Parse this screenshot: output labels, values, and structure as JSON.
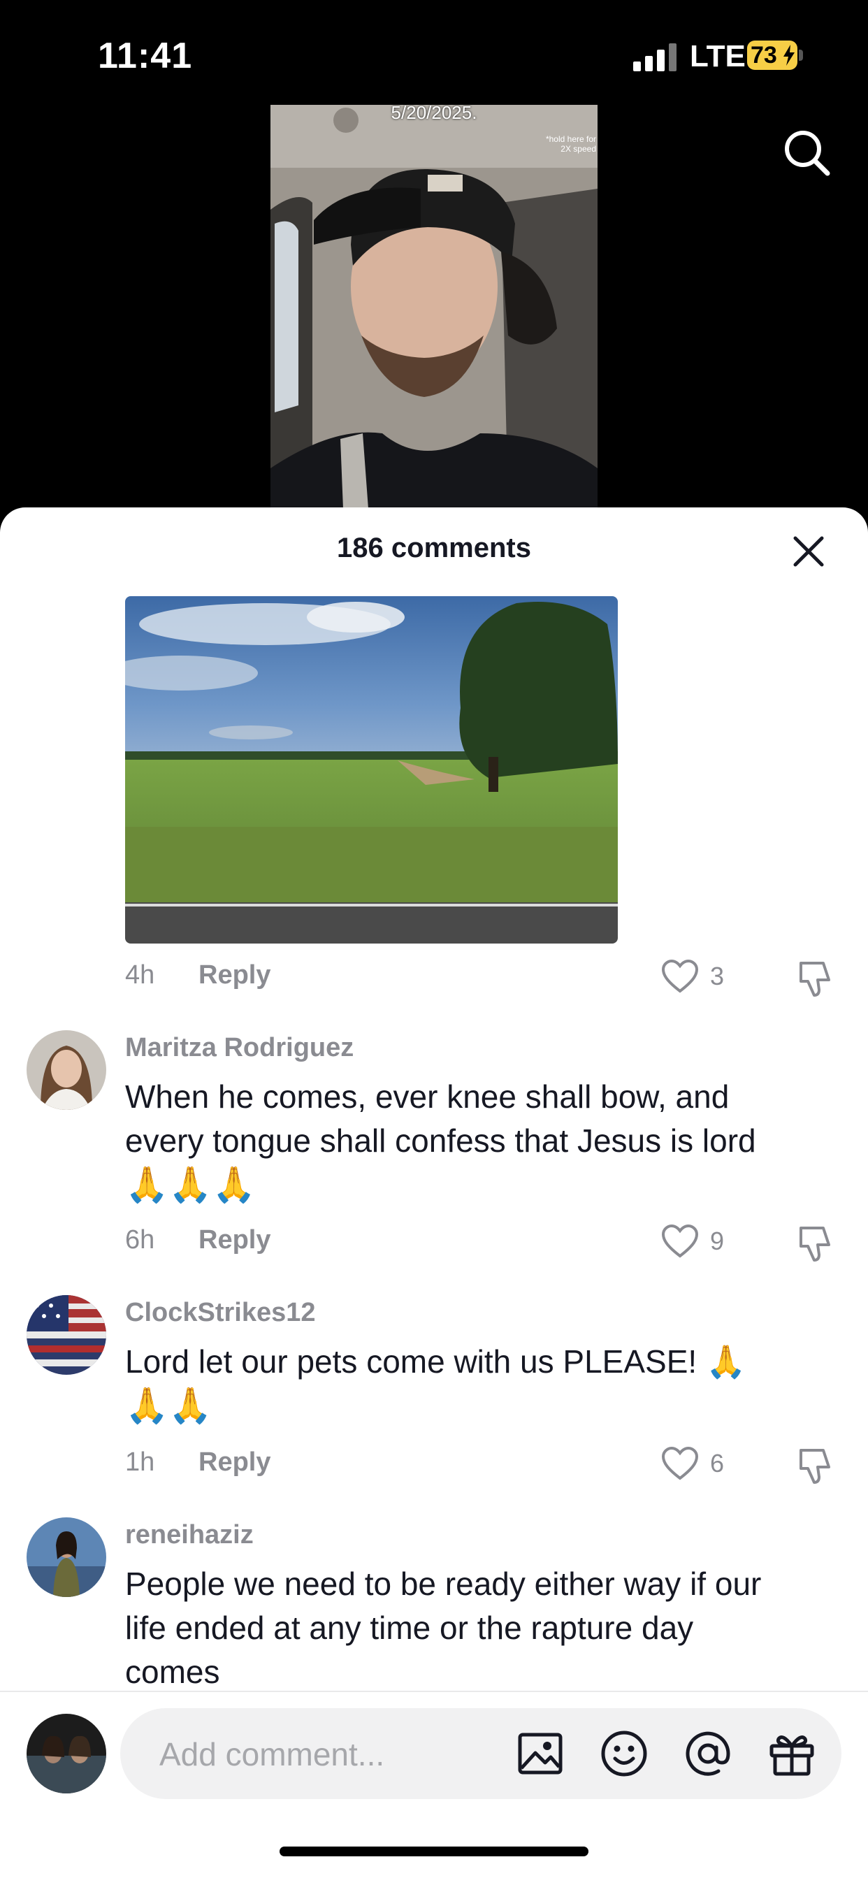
{
  "status_bar": {
    "time": "11:41",
    "network": "LTE",
    "battery": "73"
  },
  "video": {
    "date_overlay": "5/20/2025.",
    "hint_overlay": "*hold here for 2X speed"
  },
  "icons": {
    "search": "search-icon",
    "close": "close-icon",
    "heart": "heart-icon",
    "dislike": "dislike-icon",
    "image": "image-icon",
    "emoji": "emoji-icon",
    "mention": "at-icon",
    "gift": "gift-icon"
  },
  "comments_panel": {
    "title": "186 comments",
    "reply_label": "Reply",
    "first_comment": {
      "time": "4h",
      "likes": "3"
    },
    "comments": [
      {
        "username": "Maritza Rodriguez",
        "text_line1": "When he comes, ever knee shall bow, and",
        "text_line2": "every tongue shall confess that Jesus is lord",
        "emoji_line": "🙏🙏🙏",
        "time": "6h",
        "likes": "9"
      },
      {
        "username": "ClockStrikes12",
        "text_line1": "Lord let our pets come with us PLEASE! 🙏",
        "emoji_line": "🙏🙏",
        "time": "1h",
        "likes": "6"
      },
      {
        "username": "reneihaziz",
        "text_line1": "People we need to be ready either way if our",
        "text_line2": "life ended at any time or the rapture day",
        "text_line3": "comes"
      }
    ]
  },
  "composer": {
    "placeholder": "Add comment..."
  },
  "colors": {
    "accent_text": "#161823",
    "muted": "#8a8b91",
    "battery": "#f7ce46"
  }
}
